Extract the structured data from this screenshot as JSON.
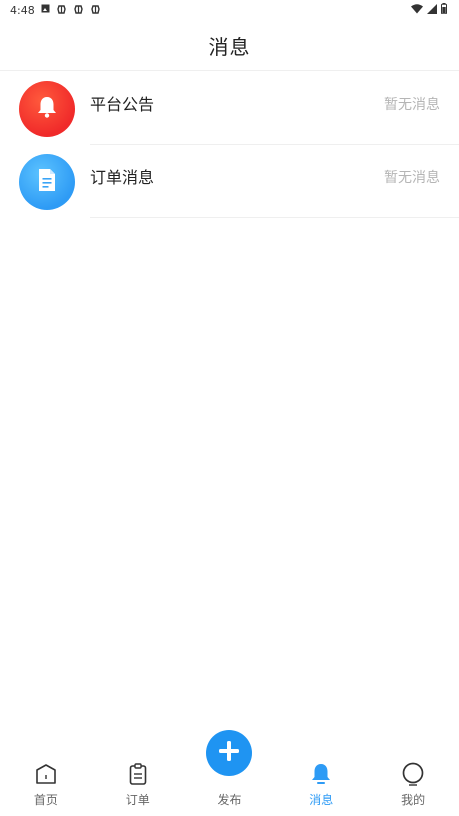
{
  "status_bar": {
    "time": "4:48",
    "notification_icons": [
      "photo-icon",
      "bug-icon",
      "bug-icon",
      "bug-icon"
    ],
    "right_icons": [
      "wifi-icon",
      "signal-icon",
      "battery-icon"
    ]
  },
  "header": {
    "title": "消息"
  },
  "messages": [
    {
      "title": "平台公告",
      "status": "暂无消息",
      "icon": "bell-icon",
      "color": "#f03a2c"
    },
    {
      "title": "订单消息",
      "status": "暂无消息",
      "icon": "document-icon",
      "color": "#2e9bf5"
    }
  ],
  "bottom_nav": {
    "items": [
      {
        "label": "首页",
        "icon": "home-icon"
      },
      {
        "label": "订单",
        "icon": "clipboard-icon"
      },
      {
        "label": "发布",
        "icon": "plus-icon"
      },
      {
        "label": "消息",
        "icon": "bell-icon"
      },
      {
        "label": "我的",
        "icon": "person-icon"
      }
    ],
    "active": "消息",
    "accent": "#2e9bf5"
  }
}
